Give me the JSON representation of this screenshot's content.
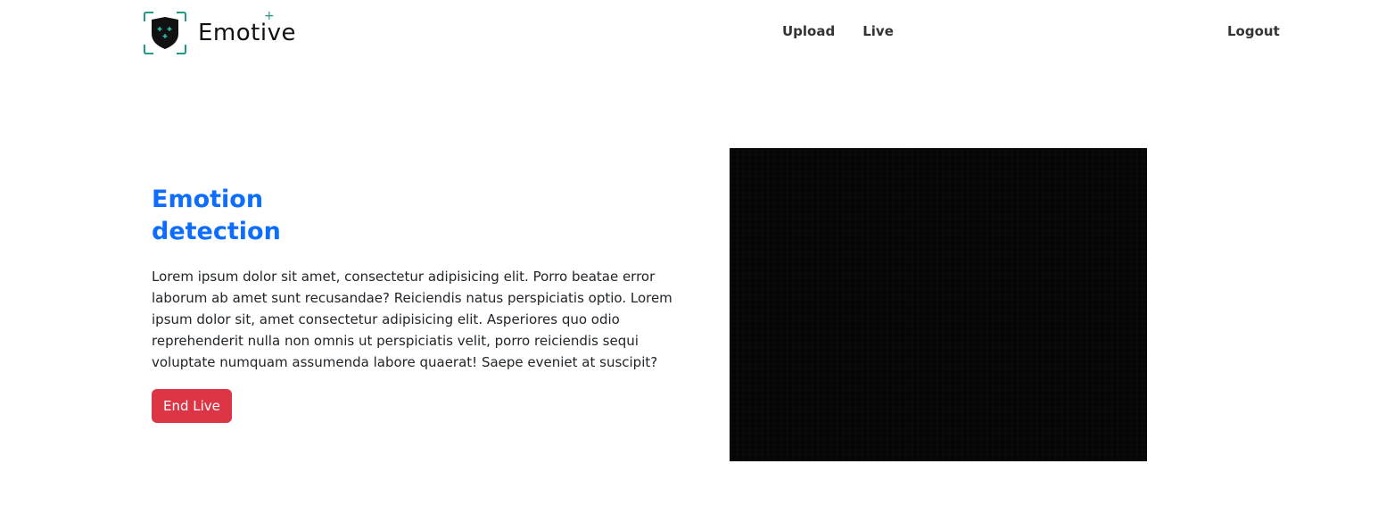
{
  "brand": {
    "name": "Emotive",
    "accent_color": "#1f9a8a"
  },
  "nav": {
    "links": [
      {
        "label": "Upload"
      },
      {
        "label": "Live"
      }
    ],
    "logout_label": "Logout"
  },
  "hero": {
    "title_line1": "Emotion",
    "title_line2": "detection",
    "title_color": "#0d6efd",
    "body": "Lorem ipsum dolor sit amet, consectetur adipisicing elit. Porro beatae error laborum ab amet sunt recusandae? Reiciendis natus perspiciatis optio. Lorem ipsum dolor sit, amet consectetur adipisicing elit. Asperiores quo odio reprehenderit nulla non omnis ut perspiciatis velit, porro reiciendis sequi voluptate numquam assumenda labore quaerat! Saepe eveniet at suscipit?",
    "end_live_label": "End Live",
    "end_live_color": "#dc3545"
  },
  "video": {
    "background_color": "#050505"
  }
}
